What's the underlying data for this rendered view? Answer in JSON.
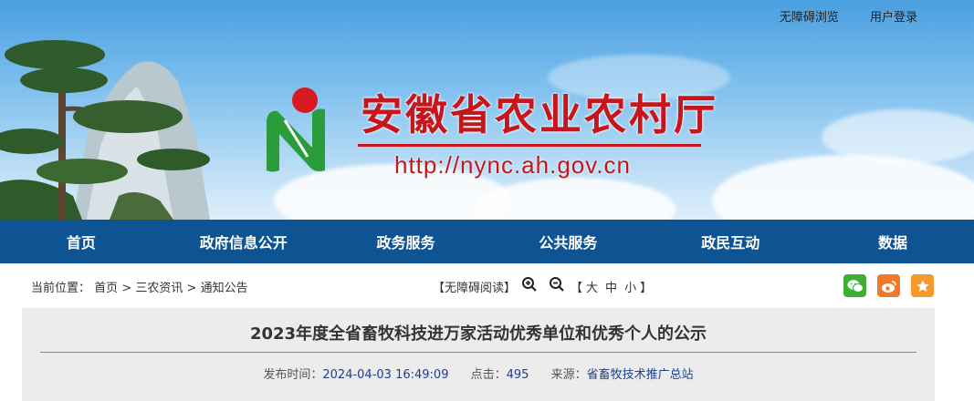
{
  "header": {
    "top_links": [
      "无障碍浏览",
      "用户登录"
    ],
    "site_title": "安徽省农业农村厅",
    "site_url": "http://nync.ah.gov.cn",
    "logo_icon": "n-logo-icon"
  },
  "nav": {
    "items": [
      "首页",
      "政府信息公开",
      "政务服务",
      "公共服务",
      "政民互动",
      "数据"
    ]
  },
  "breadcrumb": {
    "label": "当前位置：",
    "items": [
      "首页",
      "三农资讯",
      "通知公告"
    ],
    "separator": ">"
  },
  "tools": {
    "accessible_read": "【无障碍阅读】",
    "font_size_open": "【",
    "sizes": [
      "大",
      "中",
      "小"
    ],
    "font_size_close": "】"
  },
  "share": {
    "icons": [
      "wechat-icon",
      "weibo-icon",
      "favorite-icon"
    ],
    "colors": [
      "#3cb034",
      "#f07a2a",
      "#f59a2b"
    ]
  },
  "article": {
    "title": "2023年度全省畜牧科技进万家活动优秀单位和优秀个人的公示",
    "publish_label": "发布时间：",
    "publish_time": "2024-04-03 16:49:09",
    "clicks_label": "点击：",
    "clicks": "495",
    "source_label": "来源：",
    "source": "省畜牧技术推广总站"
  },
  "colors": {
    "nav_bg": "#0e5392",
    "title_red": "#c6161c",
    "meta_blue": "#1a3f8f"
  }
}
